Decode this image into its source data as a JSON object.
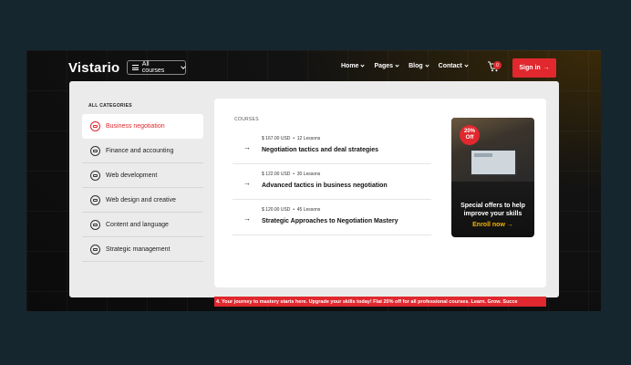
{
  "header": {
    "logo": "Vistario",
    "all_courses_label": "All courses",
    "nav": [
      {
        "label": "Home"
      },
      {
        "label": "Pages"
      },
      {
        "label": "Blog"
      },
      {
        "label": "Contact"
      }
    ],
    "cart_count": "0",
    "signin_label": "Sign in",
    "accent_color": "#e0282e"
  },
  "sidebar": {
    "title": "ALL CATEGORIES",
    "items": [
      {
        "label": "Business negotiation",
        "active": true,
        "icon": "handshake-icon"
      },
      {
        "label": "Finance and accounting",
        "icon": "finance-icon"
      },
      {
        "label": "Web development",
        "icon": "globe-icon"
      },
      {
        "label": "Web design and creative",
        "icon": "design-icon"
      },
      {
        "label": "Content and language",
        "icon": "language-icon"
      },
      {
        "label": "Strategic management",
        "icon": "management-icon"
      }
    ]
  },
  "courses": {
    "label": "COURSES",
    "items": [
      {
        "price": "$ 167.00 USD",
        "lessons": "12 Lessons",
        "title": "Negotiation tactics and deal strategies"
      },
      {
        "price": "$ 122.00 USD",
        "lessons": "30 Lessons",
        "title": "Advanced tactics in business negotiation"
      },
      {
        "price": "$ 120.00 USD",
        "lessons": "45 Lessons",
        "title": "Strategic Approaches to Negotiation Mastery"
      }
    ]
  },
  "promo": {
    "badge_percent": "20%",
    "badge_text": "Off",
    "title": "Special offers to help improve your skills",
    "cta": "Enroll now"
  },
  "ticker": {
    "text": "4.  Your journey to mastery starts here.  Upgrade your skills today!  Flat 20% off for all professional courses.  Learn. Grow. Succe"
  }
}
